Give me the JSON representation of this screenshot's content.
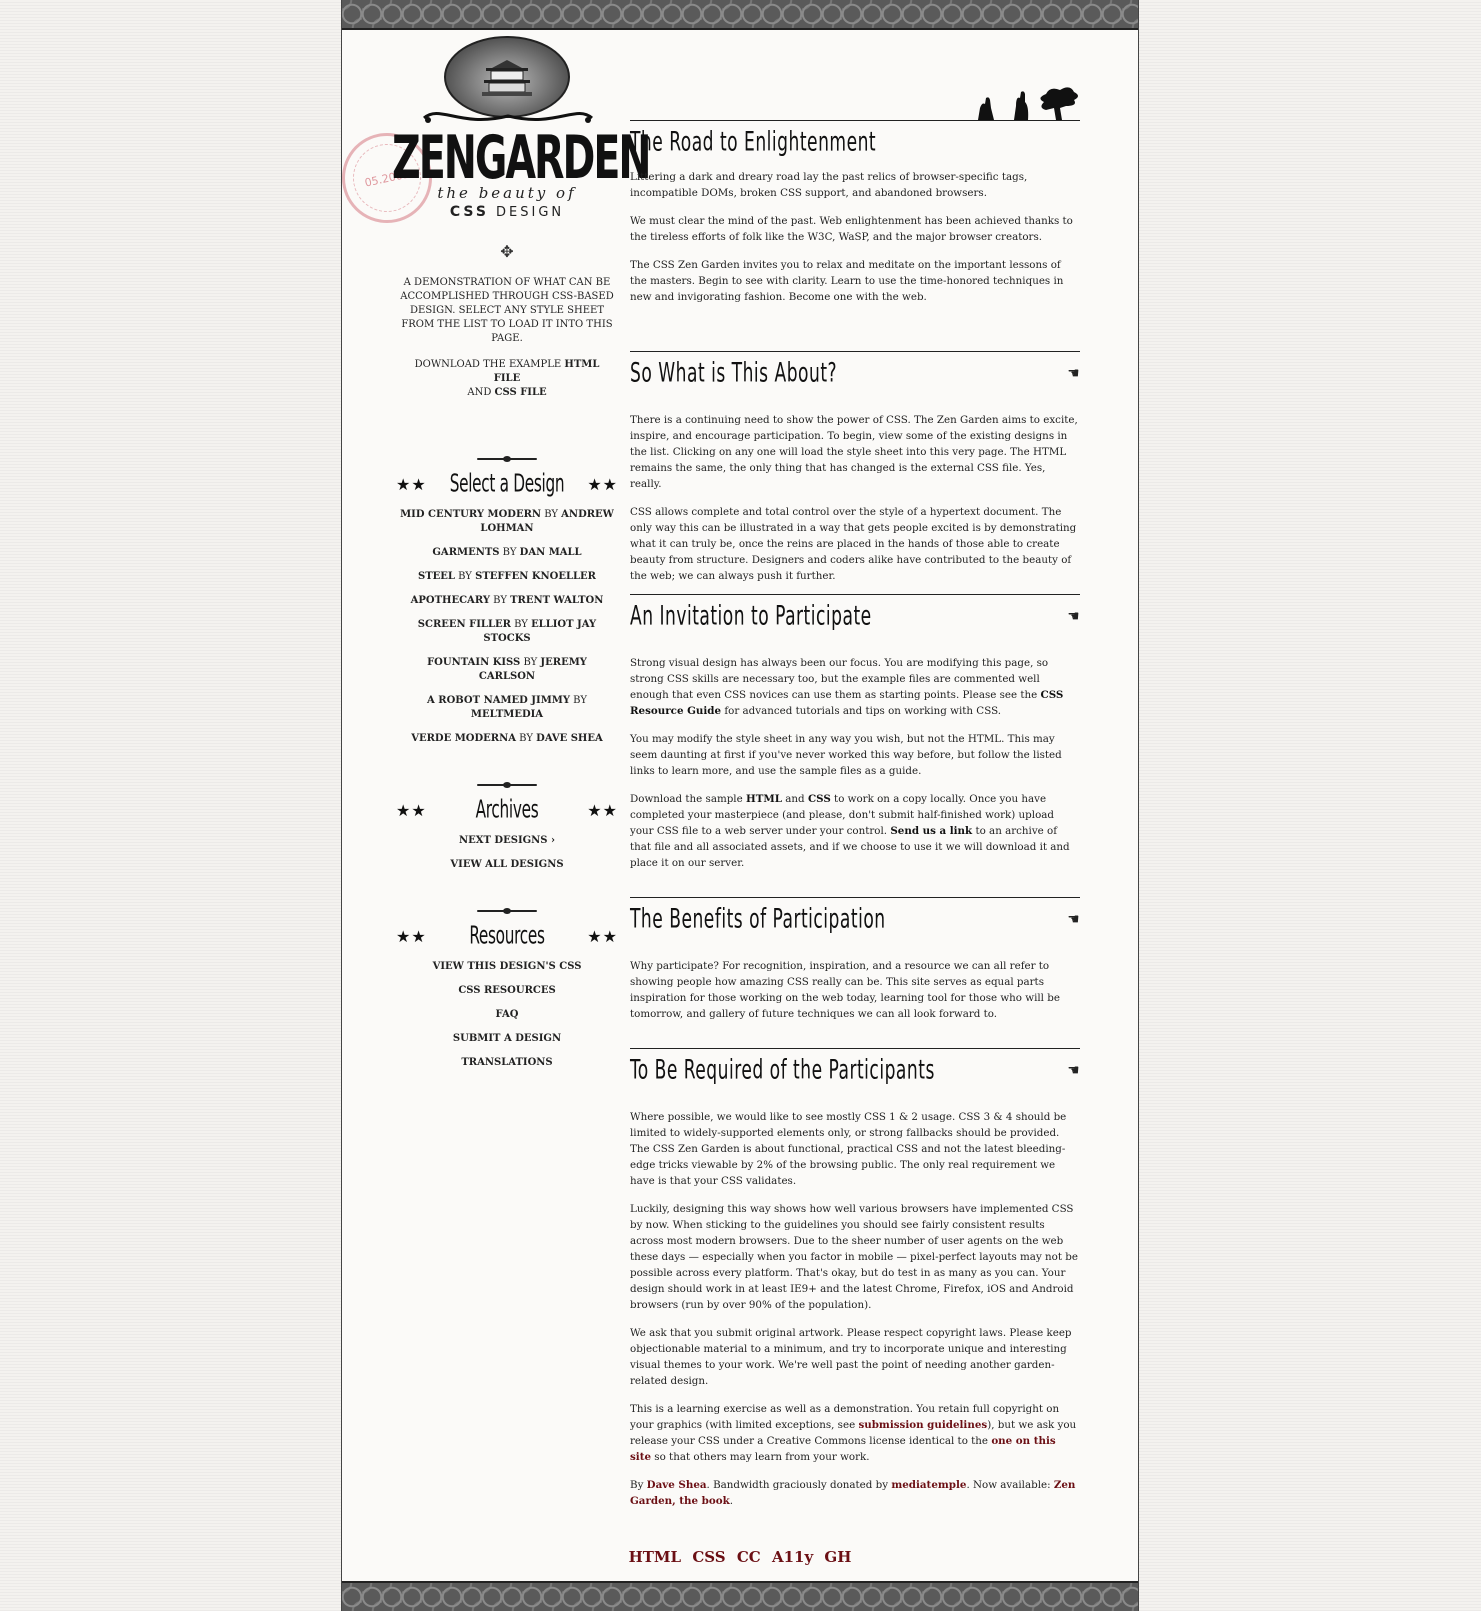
{
  "header": {
    "logo_title": "ZENGARDEN",
    "logo_subtitle": "the beauty of",
    "logo_css": "CSS",
    "logo_design": "DESIGN",
    "stamp_text": "05.2003"
  },
  "intro": {
    "summary": "A demonstration of what can be accomplished through CSS-based design. Select any style sheet from the list to load it into this page.",
    "download_prefix": "Download the example ",
    "html_file": "html file",
    "and": " and ",
    "css_file": "css file"
  },
  "select_design": {
    "heading": "Select a Design",
    "items": [
      {
        "name": "Mid Century Modern",
        "by": " by ",
        "author": "Andrew Lohman"
      },
      {
        "name": "Garments",
        "by": " by ",
        "author": "Dan Mall"
      },
      {
        "name": "Steel",
        "by": " by ",
        "author": "Steffen Knoeller"
      },
      {
        "name": "Apothecary",
        "by": " by ",
        "author": "Trent Walton"
      },
      {
        "name": "Screen Filler",
        "by": " by ",
        "author": "Elliot Jay Stocks"
      },
      {
        "name": "Fountain Kiss",
        "by": " by ",
        "author": "Jeremy Carlson"
      },
      {
        "name": "A Robot Named Jimmy",
        "by": " by ",
        "author": "meltmedia"
      },
      {
        "name": "Verde Moderna",
        "by": " by ",
        "author": "Dave Shea"
      }
    ]
  },
  "archives": {
    "heading": "Archives",
    "next": "Next Designs ›",
    "view_all": "View All Designs"
  },
  "resources": {
    "heading": "Resources",
    "items": [
      "View This Design's CSS",
      "CSS Resources",
      "FAQ",
      "Submit a Design",
      "Translations"
    ]
  },
  "sections": {
    "enlightenment": {
      "title": "The Road to Enlightenment",
      "p1": "Littering a dark and dreary road lay the past relics of browser-specific tags, incompatible DOMs, broken CSS support, and abandoned browsers.",
      "p2": "We must clear the mind of the past. Web enlightenment has been achieved thanks to the tireless efforts of folk like the W3C, WaSP, and the major browser creators.",
      "p3": "The CSS Zen Garden invites you to relax and meditate on the important lessons of the masters. Begin to see with clarity. Learn to use the time-honored techniques in new and invigorating fashion. Become one with the web."
    },
    "about": {
      "title": "So What is This About?",
      "p1": "There is a continuing need to show the power of CSS. The Zen Garden aims to excite, inspire, and encourage participation. To begin, view some of the existing designs in the list. Clicking on any one will load the style sheet into this very page. The HTML remains the same, the only thing that has changed is the external CSS file. Yes, really.",
      "p2": "CSS allows complete and total control over the style of a hypertext document. The only way this can be illustrated in a way that gets people excited is by demonstrating what it can truly be, once the reins are placed in the hands of those able to create beauty from structure. Designers and coders alike have contributed to the beauty of the web; we can always push it further."
    },
    "participate": {
      "title": "An Invitation to Participate",
      "p1_a": "Strong visual design has always been our focus. You are modifying this page, so strong CSS skills are necessary too, but the example files are commented well enough that even CSS novices can use them as starting points. Please see the ",
      "p1_link": "CSS Resource Guide",
      "p1_b": " for advanced tutorials and tips on working with CSS.",
      "p2": "You may modify the style sheet in any way you wish, but not the HTML. This may seem daunting at first if you've never worked this way before, but follow the listed links to learn more, and use the sample files as a guide.",
      "p3_a": "Download the sample ",
      "p3_html": "HTML",
      "p3_and": " and ",
      "p3_css": "CSS",
      "p3_b": " to work on a copy locally. Once you have completed your masterpiece (and please, don't submit half-finished work) upload your CSS file to a web server under your control. ",
      "p3_link": "Send us a link",
      "p3_c": " to an archive of that file and all associated assets, and if we choose to use it we will download it and place it on our server."
    },
    "benefits": {
      "title": "The Benefits of Participation",
      "p1": "Why participate? For recognition, inspiration, and a resource we can all refer to showing people how amazing CSS really can be. This site serves as equal parts inspiration for those working on the web today, learning tool for those who will be tomorrow, and gallery of future techniques we can all look forward to."
    },
    "requirements": {
      "title": "To Be Required of the Participants",
      "p1": "Where possible, we would like to see mostly CSS 1 & 2 usage. CSS 3 & 4 should be limited to widely-supported elements only, or strong fallbacks should be provided. The CSS Zen Garden is about functional, practical CSS and not the latest bleeding-edge tricks viewable by 2% of the browsing public. The only real requirement we have is that your CSS validates.",
      "p2": "Luckily, designing this way shows how well various browsers have implemented CSS by now. When sticking to the guidelines you should see fairly consistent results across most modern browsers. Due to the sheer number of user agents on the web these days — especially when you factor in mobile — pixel-perfect layouts may not be possible across every platform. That's okay, but do test in as many as you can. Your design should work in at least IE9+ and the latest Chrome, Firefox, iOS and Android browsers (run by over 90% of the population).",
      "p3": "We ask that you submit original artwork. Please respect copyright laws. Please keep objectionable material to a minimum, and try to incorporate unique and interesting visual themes to your work. We're well past the point of needing another garden-related design.",
      "p4_a": "This is a learning exercise as well as a demonstration. You retain full copyright on your graphics (with limited exceptions, see ",
      "p4_link1": "submission guidelines",
      "p4_b": "), but we ask you release your CSS under a Creative Commons license identical to the ",
      "p4_link2": "one on this site",
      "p4_c": " so that others may learn from your work.",
      "p5_a": "By ",
      "p5_link1": "Dave Shea",
      "p5_b": ". Bandwidth graciously donated by ",
      "p5_link2": "mediatemple",
      "p5_c": ". Now available: ",
      "p5_link3": "Zen Garden, the book",
      "p5_d": "."
    }
  },
  "footer": {
    "links": [
      "HTML",
      "CSS",
      "CC",
      "A11y",
      "GH"
    ]
  },
  "colors": {
    "link_red": "#6b0f14",
    "stamp_pink": "#d67882",
    "band_gray": "#5a5a5a"
  },
  "icons": {
    "section_marker": "pointing-hand-icon",
    "list_marker": "star-icon"
  }
}
